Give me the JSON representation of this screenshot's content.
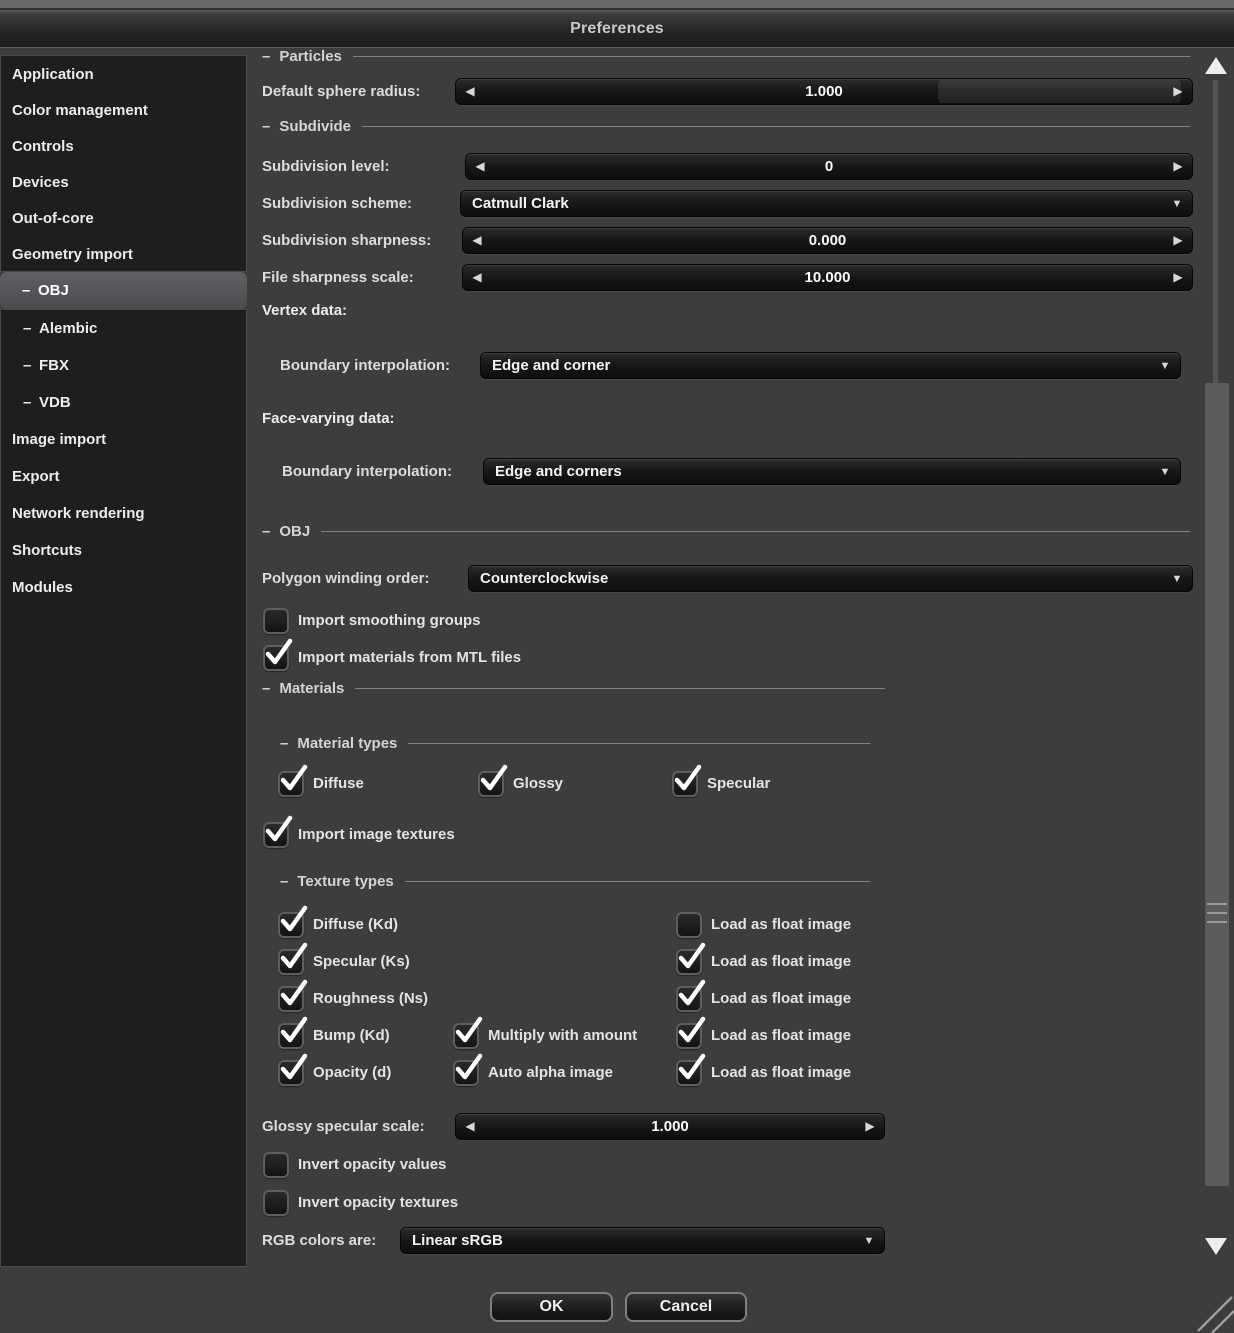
{
  "window": {
    "title": "Preferences"
  },
  "icons": {
    "slider_decrement": "◀",
    "slider_increment": "▶",
    "dropdown_arrow": "▼",
    "scroll_up": "scroll-up-triangle",
    "scroll_down": "scroll-down-triangle",
    "checkmark": "check"
  },
  "colors": {
    "content_bg": "#3d3d3d",
    "sidebar_bg": "#1e1e1e",
    "control_bg": "#141414",
    "selected_item_bg": "#565659",
    "text": "#e2e2e2",
    "divider": "#919191"
  },
  "sidebar": {
    "items": [
      {
        "label": "Application"
      },
      {
        "label": "Color management"
      },
      {
        "label": "Controls"
      },
      {
        "label": "Devices"
      },
      {
        "label": "Out-of-core"
      },
      {
        "label": "Geometry import"
      },
      {
        "dash": "–",
        "label": "OBJ",
        "selected": true
      },
      {
        "dash": "–",
        "label": "Alembic"
      },
      {
        "dash": "–",
        "label": "FBX"
      },
      {
        "dash": "–",
        "label": "VDB"
      },
      {
        "label": "Image import"
      },
      {
        "label": "Export"
      },
      {
        "label": "Network rendering"
      },
      {
        "label": "Shortcuts"
      },
      {
        "label": "Modules"
      }
    ]
  },
  "content": {
    "sections": {
      "particles": {
        "dash": "–",
        "title": "Particles"
      },
      "subdivide": {
        "dash": "–",
        "title": "Subdivide"
      },
      "obj": {
        "dash": "–",
        "title": "OBJ"
      },
      "materials": {
        "dash": "–",
        "title": "Materials"
      },
      "material_types": {
        "dash": "–",
        "title": "Material types"
      },
      "texture_types": {
        "dash": "–",
        "title": "Texture types"
      }
    },
    "fields": {
      "default_sphere_radius": {
        "label": "Default sphere radius:",
        "value": "1.000",
        "control": "slider"
      },
      "subdivision_level": {
        "label": "Subdivision level:",
        "value": "0",
        "control": "slider"
      },
      "subdivision_scheme": {
        "label": "Subdivision scheme:",
        "value": "Catmull Clark",
        "control": "dropdown"
      },
      "subdivision_sharpness": {
        "label": "Subdivision sharpness:",
        "value": "0.000",
        "control": "slider"
      },
      "file_sharpness_scale": {
        "label": "File sharpness scale:",
        "value": "10.000",
        "control": "slider"
      },
      "vertex_data_heading": "Vertex data:",
      "vertex_boundary_interpolation": {
        "label": "Boundary interpolation:",
        "value": "Edge and corner",
        "control": "dropdown"
      },
      "face_varying_heading": "Face-varying data:",
      "face_boundary_interpolation": {
        "label": "Boundary interpolation:",
        "value": "Edge and corners",
        "control": "dropdown"
      },
      "polygon_winding_order": {
        "label": "Polygon winding order:",
        "value": "Counterclockwise",
        "control": "dropdown"
      },
      "import_smoothing_groups": {
        "label": "Import smoothing groups",
        "checked": false
      },
      "import_materials_mtl": {
        "label": "Import materials from MTL files",
        "checked": true
      },
      "material_types": [
        {
          "label": "Diffuse",
          "checked": true
        },
        {
          "label": "Glossy",
          "checked": true
        },
        {
          "label": "Specular",
          "checked": true
        }
      ],
      "import_image_textures": {
        "label": "Import image textures",
        "checked": true
      },
      "texture_rows": [
        {
          "type": {
            "label": "Diffuse (Kd)",
            "checked": true
          },
          "load_float": {
            "label": "Load as float image",
            "checked": false
          }
        },
        {
          "type": {
            "label": "Specular (Ks)",
            "checked": true
          },
          "load_float": {
            "label": "Load as float image",
            "checked": true
          }
        },
        {
          "type": {
            "label": "Roughness (Ns)",
            "checked": true
          },
          "load_float": {
            "label": "Load as float image",
            "checked": true
          }
        },
        {
          "type": {
            "label": "Bump (Kd)",
            "checked": true
          },
          "extra": {
            "label": "Multiply with amount",
            "checked": true
          },
          "load_float": {
            "label": "Load as float image",
            "checked": true
          }
        },
        {
          "type": {
            "label": "Opacity (d)",
            "checked": true
          },
          "extra": {
            "label": "Auto alpha image",
            "checked": true
          },
          "load_float": {
            "label": "Load as float image",
            "checked": true
          }
        }
      ],
      "glossy_specular_scale": {
        "label": "Glossy specular scale:",
        "value": "1.000",
        "control": "slider"
      },
      "invert_opacity_values": {
        "label": "Invert opacity values",
        "checked": false
      },
      "invert_opacity_textures": {
        "label": "Invert opacity textures",
        "checked": false
      },
      "rgb_colors_are": {
        "label": "RGB colors are:",
        "value": "Linear sRGB",
        "control": "dropdown"
      }
    }
  },
  "footer": {
    "ok_label": "OK",
    "cancel_label": "Cancel"
  }
}
